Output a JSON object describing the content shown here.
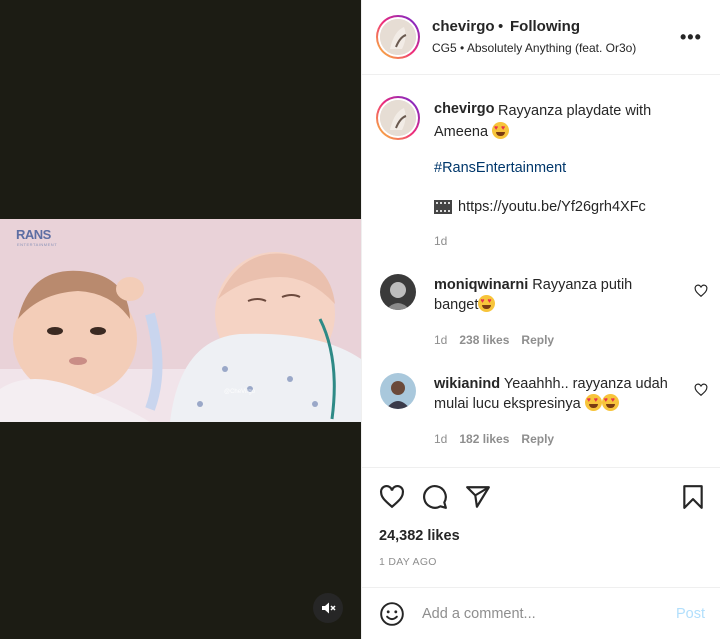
{
  "post": {
    "username": "chevirgo",
    "separator": "•",
    "follow_status": "Following",
    "audio": "CG5 • Absolutely Anything (feat. Or3o)",
    "caption": {
      "username": "chevirgo",
      "text": "Rayyanza playdate with Ameena",
      "hashtag": "#RansEntertainment",
      "link": "https://youtu.be/Yf26grh4XFc",
      "time": "1d"
    },
    "comments": [
      {
        "username": "moniqwinarni",
        "text": "Rayyanza putih banget",
        "time": "1d",
        "likes": "238 likes",
        "reply": "Reply"
      },
      {
        "username": "wikianind",
        "text": "Yeaahhh.. rayyanza udah mulai lucu ekspresinya",
        "time": "1d",
        "likes": "182 likes",
        "reply": "Reply"
      }
    ],
    "likes_count": "24,382 likes",
    "date": "1 DAY AGO",
    "comment_placeholder": "Add a comment...",
    "post_button": "Post"
  },
  "video": {
    "brand": "RANS",
    "brand_sub": "ENTERTAINMENT",
    "watermark": "@CheVirgo"
  },
  "icons": {
    "more": "more-icon",
    "like": "heart-icon",
    "comment": "comment-icon",
    "share": "share-icon",
    "save": "bookmark-icon",
    "emoji": "emoji-icon",
    "mute": "muted-speaker-icon"
  },
  "colors": {
    "link": "#00376b",
    "post_disabled": "#b2dffc",
    "meta": "#8e8e8e"
  }
}
